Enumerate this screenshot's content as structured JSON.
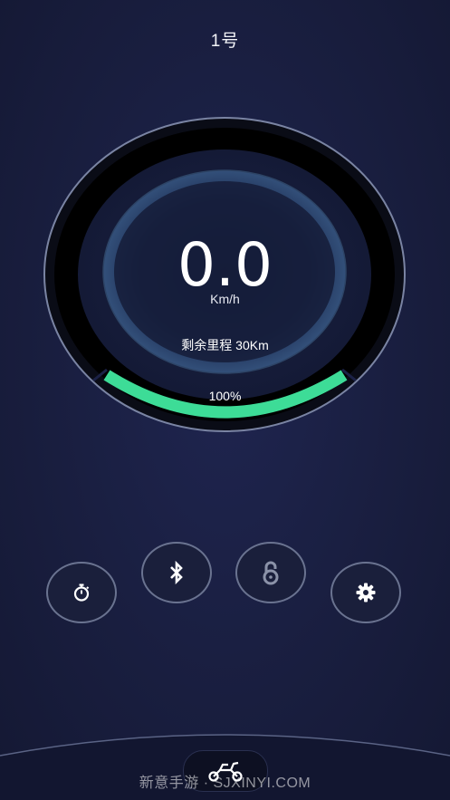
{
  "header": {
    "title": "1号"
  },
  "dashboard": {
    "speed": "0.0",
    "speed_unit": "Km/h",
    "remaining_range": "剩余里程 30Km",
    "battery_label": "100%",
    "battery_level": 1.0,
    "accent_color": "#3ddc97"
  },
  "controls": [
    {
      "icon": "stopwatch-icon"
    },
    {
      "icon": "bluetooth-icon"
    },
    {
      "icon": "lock-icon"
    },
    {
      "icon": "gear-icon"
    }
  ],
  "footer": {
    "home_icon": "scooter-icon",
    "watermark": "新意手游 · SJXINYI.COM"
  }
}
